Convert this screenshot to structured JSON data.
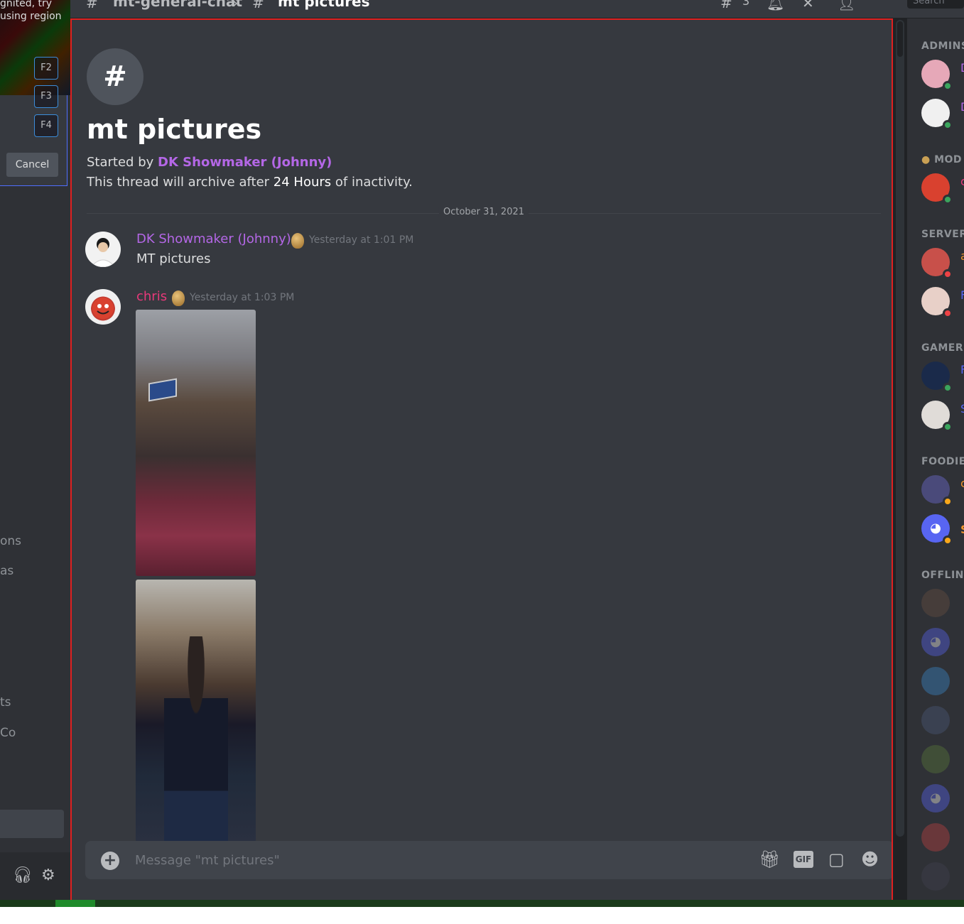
{
  "topbar": {
    "channel": "mt-general-chat",
    "thread": "mt pictures",
    "threads_count": "3",
    "search_placeholder": "Search"
  },
  "left_sidebar": {
    "hint_line1": "gnited, try",
    "hint_line2": "using region",
    "fkeys": [
      "F2",
      "F3",
      "F4"
    ],
    "cancel": "Cancel",
    "fragments": [
      "ons",
      "as",
      "ts",
      "Co"
    ]
  },
  "thread": {
    "icon": "#",
    "title": "mt pictures",
    "started_by_prefix": "Started by",
    "started_by_author": "DK Showmaker (Johnny)",
    "archive_prefix": "This thread will archive after",
    "archive_duration": "24 Hours",
    "archive_suffix": "of inactivity.",
    "date_divider": "October 31, 2021",
    "messages": [
      {
        "author": "DK Showmaker (Johnny)",
        "author_color": "#b467e6",
        "time": "Yesterday at 1:01 PM",
        "text": "MT pictures"
      },
      {
        "author": "chris",
        "author_color": "#e8397a",
        "time": "Yesterday at 1:03 PM",
        "text": ""
      }
    ]
  },
  "composer": {
    "placeholder": "Message \"mt pictures\"",
    "gif_label": "GIF"
  },
  "members": {
    "groups": [
      "ADMINS",
      "MOD",
      "SERVER",
      "GAMER",
      "FOODIE",
      "OFFLINE"
    ]
  },
  "colors": {
    "accent": "#5865f2",
    "online": "#3ba55d",
    "dnd": "#ed4245",
    "idle": "#faa81a",
    "highlight_border": "#e02020"
  }
}
